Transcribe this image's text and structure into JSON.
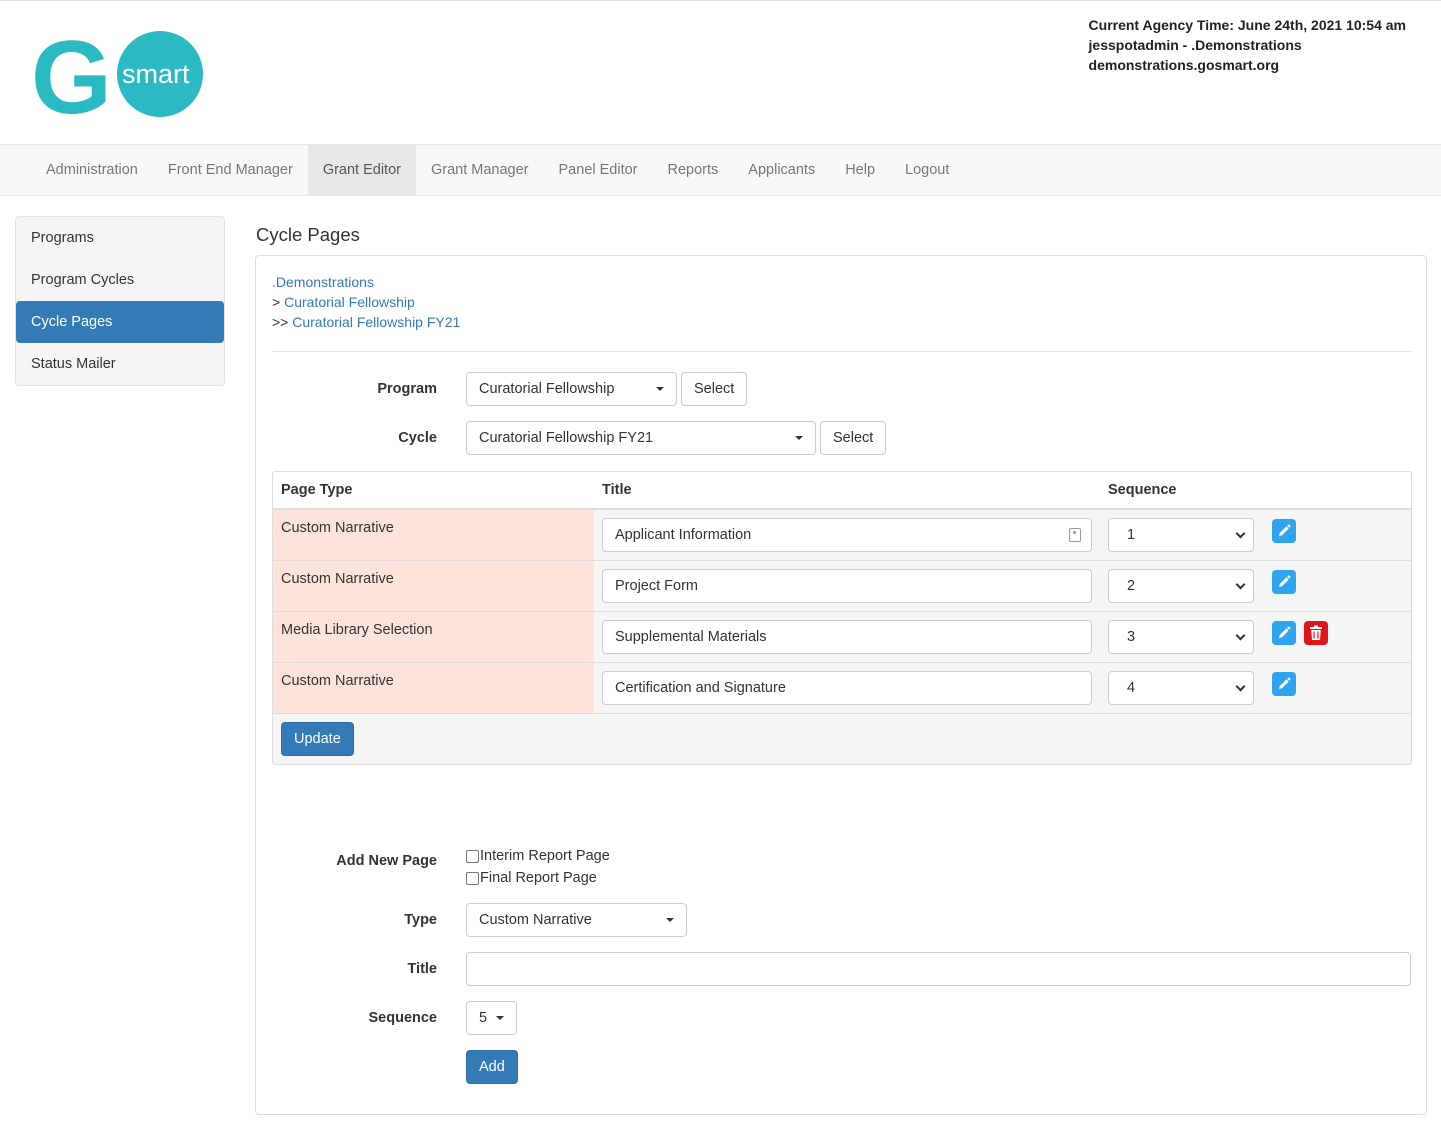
{
  "header": {
    "logo_text_g": "G",
    "logo_text_smart": "smart",
    "agency_time": "Current Agency Time: June 24th, 2021 10:54 am",
    "user_line": "jesspotadmin - .Demonstrations",
    "domain_line": "demonstrations.gosmart.org"
  },
  "nav": {
    "items": [
      {
        "label": "Administration"
      },
      {
        "label": "Front End Manager"
      },
      {
        "label": "Grant Editor"
      },
      {
        "label": "Grant Manager"
      },
      {
        "label": "Panel Editor"
      },
      {
        "label": "Reports"
      },
      {
        "label": "Applicants"
      },
      {
        "label": "Help"
      },
      {
        "label": "Logout"
      }
    ],
    "active": "Grant Editor"
  },
  "sidebar": {
    "items": [
      {
        "label": "Programs"
      },
      {
        "label": "Program Cycles"
      },
      {
        "label": "Cycle Pages"
      },
      {
        "label": "Status Mailer"
      }
    ],
    "active": "Cycle Pages"
  },
  "main": {
    "title": "Cycle Pages",
    "breadcrumb": {
      "level1": ".Demonstrations",
      "sep2": ">",
      "level2": "Curatorial Fellowship",
      "sep3": ">>",
      "level3": "Curatorial Fellowship FY21"
    },
    "program": {
      "label": "Program",
      "value": "Curatorial Fellowship",
      "button": "Select"
    },
    "cycle": {
      "label": "Cycle",
      "value": "Curatorial Fellowship FY21",
      "button": "Select"
    },
    "table": {
      "headers": {
        "page_type": "Page Type",
        "title": "Title",
        "sequence": "Sequence"
      },
      "rows": [
        {
          "page_type": "Custom Narrative",
          "title": "Applicant Information",
          "sequence": "1",
          "deletable": false
        },
        {
          "page_type": "Custom Narrative",
          "title": "Project Form",
          "sequence": "2",
          "deletable": false
        },
        {
          "page_type": "Media Library Selection",
          "title": "Supplemental Materials",
          "sequence": "3",
          "deletable": true
        },
        {
          "page_type": "Custom Narrative",
          "title": "Certification and Signature",
          "sequence": "4",
          "deletable": false
        }
      ],
      "update_button": "Update"
    },
    "add_new": {
      "label": "Add New Page",
      "interim_label": "Interim Report Page",
      "final_label": "Final Report Page",
      "type_label": "Type",
      "type_value": "Custom Narrative",
      "title_label": "Title",
      "title_value": "",
      "sequence_label": "Sequence",
      "sequence_value": "5",
      "add_button": "Add"
    }
  },
  "colors": {
    "logo_teal": "#2bb9c2",
    "primary": "#337ab7",
    "edit_blue": "#2fa4f0",
    "delete_red": "#e0151b",
    "row_highlight": "#fde3d9"
  }
}
